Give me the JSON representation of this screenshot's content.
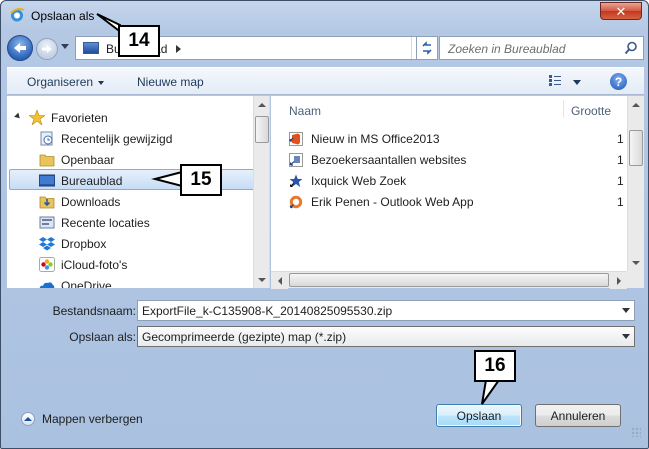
{
  "window": {
    "title": "Opslaan als",
    "close_glyph": "✕"
  },
  "navigation": {
    "address_crumb": "Bureaublad",
    "search_placeholder": "Zoeken in Bureaublad"
  },
  "toolbar": {
    "organize_label": "Organiseren",
    "new_folder_label": "Nieuwe map",
    "help_glyph": "?"
  },
  "nav_tree": {
    "favorites_label": "Favorieten",
    "items": [
      {
        "label": "Recentelijk gewijzigd",
        "icon": "recent-icon"
      },
      {
        "label": "Openbaar",
        "icon": "folder-icon"
      },
      {
        "label": "Bureaublad",
        "icon": "desktop-icon",
        "selected": true
      },
      {
        "label": "Downloads",
        "icon": "downloads-icon"
      },
      {
        "label": "Recente locaties",
        "icon": "recent-places-icon"
      },
      {
        "label": "Dropbox",
        "icon": "dropbox-icon"
      },
      {
        "label": "iCloud-foto's",
        "icon": "icloud-photos-icon"
      },
      {
        "label": "OneDrive",
        "icon": "onedrive-icon"
      }
    ]
  },
  "file_list": {
    "columns": [
      "Naam",
      "Grootte"
    ],
    "rows": [
      {
        "name": "Nieuw in MS Office2013",
        "size": "1",
        "icon": "office-shortcut-icon"
      },
      {
        "name": "Bezoekersaantallen websites",
        "size": "1",
        "icon": "shortcut-icon"
      },
      {
        "name": "Ixquick Web Zoek",
        "size": "1",
        "icon": "ixquick-shortcut-icon"
      },
      {
        "name": "Erik Penen - Outlook Web App",
        "size": "1",
        "icon": "outlook-shortcut-icon"
      }
    ]
  },
  "form": {
    "filename_label": "Bestandsnaam:",
    "filename_value": "ExportFile_k-C135908-K_20140825095530.zip",
    "savetype_label": "Opslaan als:",
    "savetype_value": "Gecomprimeerde (gezipte) map (*.zip)"
  },
  "footer": {
    "hide_folders_label": "Mappen verbergen",
    "save_label": "Opslaan",
    "cancel_label": "Annuleren"
  },
  "callouts": {
    "c14": "14",
    "c15": "15",
    "c16": "16"
  }
}
